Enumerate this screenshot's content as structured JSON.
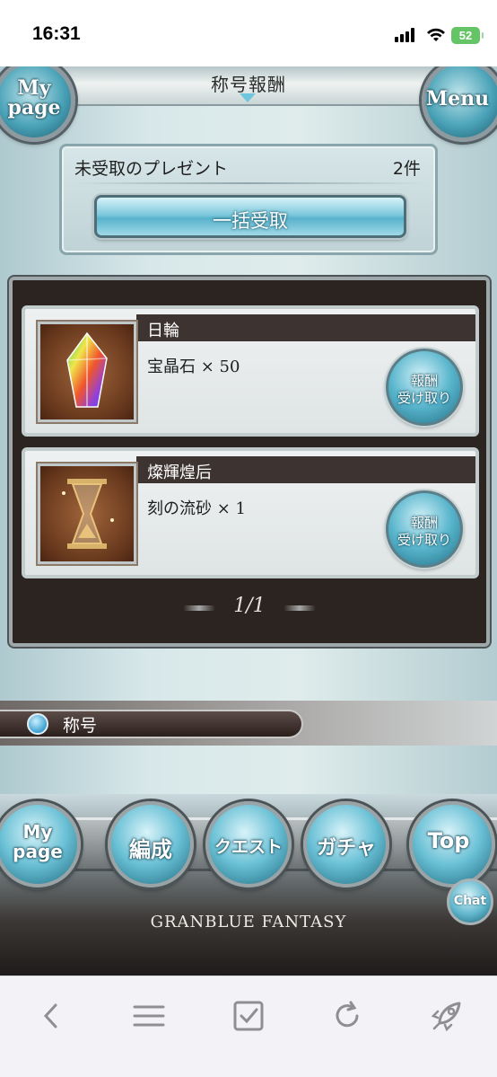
{
  "status_bar": {
    "time": "16:31",
    "battery": "52"
  },
  "header": {
    "title": "称号報酬",
    "mypage_label": [
      "My",
      "page"
    ],
    "menu_label": "Menu"
  },
  "present": {
    "label": "未受取のプレゼント",
    "count": "2件",
    "bulk_button": "一括受取"
  },
  "rewards": [
    {
      "name": "日輪",
      "item": "宝晶石 × 50",
      "icon": "rainbow-crystal-icon",
      "button": [
        "報酬",
        "受け取り"
      ]
    },
    {
      "name": "燦輝煌后",
      "item": "刻の流砂 × 1",
      "icon": "hourglass-sand-icon",
      "button": [
        "報酬",
        "受け取り"
      ]
    }
  ],
  "pager": "1/1",
  "title_tab": {
    "label": "称号"
  },
  "bottom_nav": {
    "mypage": [
      "My",
      "page"
    ],
    "party": "編成",
    "quest": "クエスト",
    "gacha": "ガチャ",
    "top": "Top",
    "chat": "Chat",
    "logo": "GRANBLUE FANTASY"
  },
  "browser_toolbar": [
    "back-icon",
    "menu-icon",
    "checkbox-icon",
    "reload-icon",
    "rocket-icon"
  ]
}
